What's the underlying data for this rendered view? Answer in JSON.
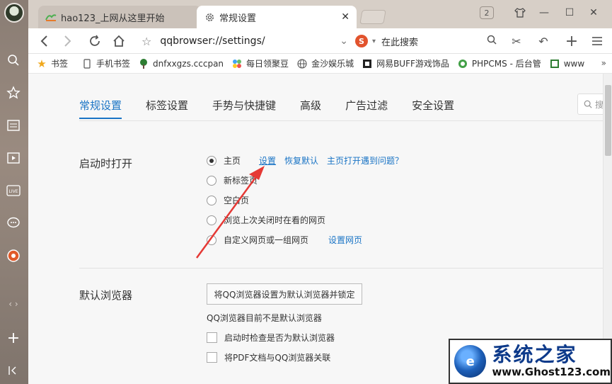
{
  "tabs": [
    {
      "title": "hao123_上网从这里开始",
      "active": false
    },
    {
      "title": "常规设置",
      "active": true
    }
  ],
  "tab_count": "2",
  "address": {
    "url": "qqbrowser://settings/"
  },
  "search": {
    "placeholder": "在此搜索"
  },
  "bookmarks": [
    {
      "label": "书签",
      "icon": "star-icon"
    },
    {
      "label": "手机书签",
      "icon": "phone-icon"
    },
    {
      "label": "dnfxxgzs.cccpan",
      "icon": "tree-icon"
    },
    {
      "label": "每日领聚豆",
      "icon": "flower-icon"
    },
    {
      "label": "金沙娱乐城",
      "icon": "globe-icon"
    },
    {
      "label": "网易BUFF游戏饰品",
      "icon": "netease-icon"
    },
    {
      "label": "PHPCMS - 后台管",
      "icon": "phpcms-icon"
    },
    {
      "label": "www",
      "icon": "page-icon"
    }
  ],
  "settings_tabs": [
    "常规设置",
    "标签设置",
    "手势与快捷键",
    "高级",
    "广告过滤",
    "安全设置"
  ],
  "settings_search_placeholder": "搜",
  "startup": {
    "label": "启动时打开",
    "options": [
      {
        "label": "主页",
        "selected": true
      },
      {
        "label": "新标签页",
        "selected": false
      },
      {
        "label": "空白页",
        "selected": false
      },
      {
        "label": "浏览上次关闭时在看的网页",
        "selected": false
      },
      {
        "label": "自定义网页或一组网页",
        "selected": false
      }
    ],
    "home_links": {
      "set": "设置",
      "restore": "恢复默认",
      "problem": "主页打开遇到问题？"
    },
    "custom_link": "设置网页"
  },
  "default_browser": {
    "label": "默认浏览器",
    "button": "将QQ浏览器设置为默认浏览器并锁定",
    "status": "QQ浏览器目前不是默认浏览器",
    "checkboxes": [
      {
        "label": "启动时检查是否为默认浏览器",
        "checked": false
      },
      {
        "label": "将PDF文档与QQ浏览器关联",
        "checked": false
      }
    ]
  },
  "watermark": {
    "title": "系统之家",
    "url": "www.Ghost123.com"
  },
  "colors": {
    "accent": "#1a74c5",
    "annotation_arrow": "#e53935"
  }
}
